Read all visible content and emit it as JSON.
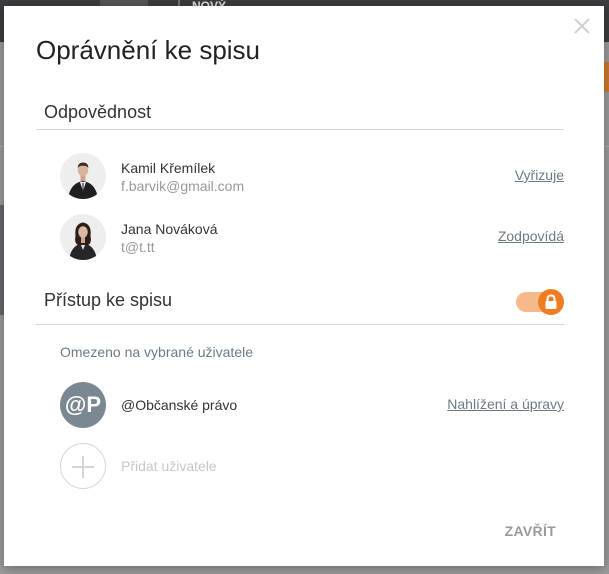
{
  "background": {
    "new_button_label": "NOVÝ"
  },
  "dialog": {
    "title": "Oprávnění ke spisu",
    "responsibility_section": {
      "heading": "Odpovědnost",
      "people": [
        {
          "name": "Kamil Křemílek",
          "email": "f.barvik@gmail.com",
          "role": "Vyřizuje"
        },
        {
          "name": "Jana Nováková",
          "email": "t@t.tt",
          "role": "Zodpovídá"
        }
      ]
    },
    "access_section": {
      "heading": "Přístup ke spisu",
      "restricted_enabled": true,
      "restricted_note": "Omezeno na vybrané uživatele",
      "groups": [
        {
          "avatar_initials": "@P",
          "name": "@Občanské právo",
          "permission": "Nahlížení a úpravy"
        }
      ],
      "add_user_label": "Přidat uživatele"
    },
    "close_label": "ZAVŘÍT"
  },
  "colors": {
    "accent_orange": "#f07c22",
    "toggle_track": "#f6b98c",
    "group_avatar": "#7a8891",
    "link": "#6c7a84"
  },
  "icons": [
    "close-icon",
    "lock-icon",
    "plus-icon"
  ]
}
